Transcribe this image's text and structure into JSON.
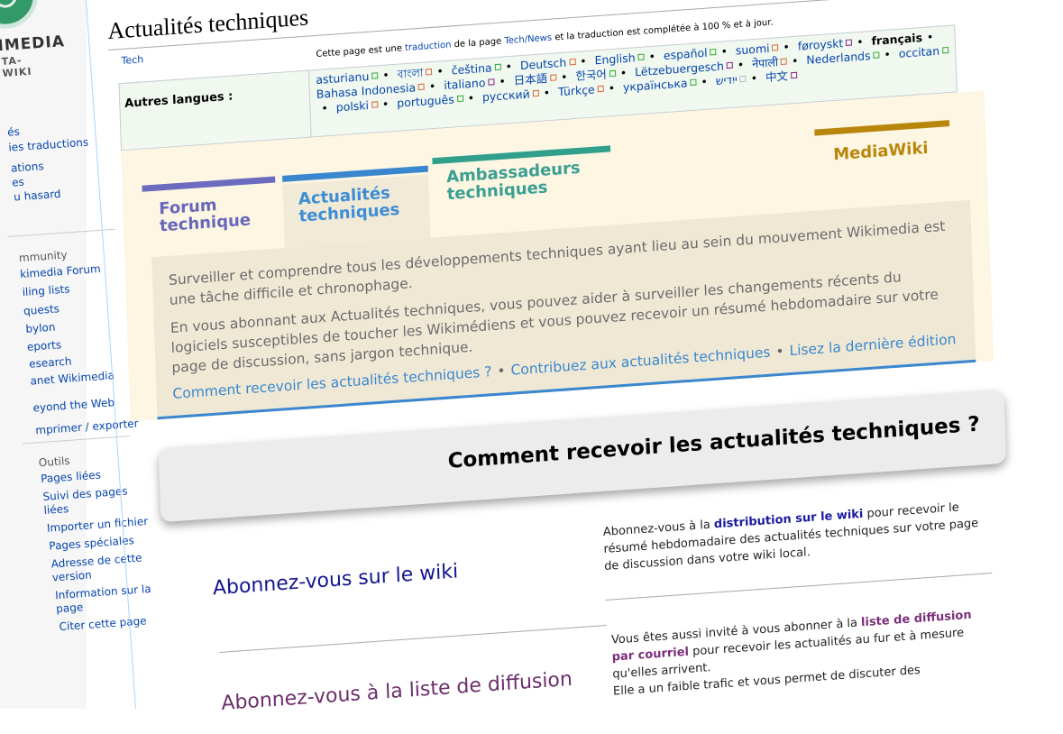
{
  "brand": {
    "logo_text": "IMEDIA",
    "logo_subtext": "TA-WIKI"
  },
  "sidebar": {
    "main_items": [
      {
        "label": "és"
      },
      {
        "label": "ies traductions"
      },
      {
        "label": "ations"
      },
      {
        "label": "es"
      },
      {
        "label": "u hasard"
      }
    ],
    "community_heading": "mmunity",
    "community_items": [
      {
        "label": "kimedia Forum"
      },
      {
        "label": "iling lists"
      },
      {
        "label": "quests"
      },
      {
        "label": "bylon"
      },
      {
        "label": "eports"
      },
      {
        "label": "esearch"
      },
      {
        "label": "anet Wikimedia"
      },
      {
        "label": "eyond the Web"
      }
    ],
    "print_item": "mprimer / exporter",
    "tools_heading": "Outils",
    "tools_items": [
      {
        "label": "Pages liées"
      },
      {
        "label": "Suivi des pages liées"
      },
      {
        "label": "Importer un fichier"
      },
      {
        "label": "Pages spéciales"
      },
      {
        "label": "Adresse de cette version"
      },
      {
        "label": "Information sur la page"
      },
      {
        "label": "Citer cette page"
      }
    ]
  },
  "page": {
    "title": "Actualités techniques",
    "breadcrumb": "Tech",
    "translation_notice": {
      "prefix": "Cette page est une ",
      "link1": "traduction",
      "middle": " de la page ",
      "link2": "Tech/News",
      "suffix": " et la traduction est complétée à 100 % et à jour."
    }
  },
  "languages": {
    "label": "Autres langues :",
    "items": [
      {
        "name": "asturianu",
        "status": "g"
      },
      {
        "name": "বাংলা",
        "status": "o"
      },
      {
        "name": "čeština",
        "status": "g"
      },
      {
        "name": "Deutsch",
        "status": "o"
      },
      {
        "name": "English",
        "status": "g"
      },
      {
        "name": "español",
        "status": "g"
      },
      {
        "name": "suomi",
        "status": "o"
      },
      {
        "name": "føroyskt",
        "status": "p"
      },
      {
        "name": "français",
        "status": ""
      },
      {
        "name": "Bahasa Indonesia",
        "status": "o"
      },
      {
        "name": "italiano",
        "status": "p"
      },
      {
        "name": "日本語",
        "status": "o"
      },
      {
        "name": "한국어",
        "status": "g"
      },
      {
        "name": "Lëtzebuergesch",
        "status": "p"
      },
      {
        "name": "नेपाली",
        "status": "o"
      },
      {
        "name": "Nederlands",
        "status": "g"
      },
      {
        "name": "occitan",
        "status": "g"
      },
      {
        "name": "polski",
        "status": "o"
      },
      {
        "name": "português",
        "status": "g"
      },
      {
        "name": "русский",
        "status": "o"
      },
      {
        "name": "Türkçe",
        "status": "o"
      },
      {
        "name": "українська",
        "status": "g"
      },
      {
        "name": "ייִדיש",
        "status": "x"
      },
      {
        "name": "中文",
        "status": "p"
      }
    ]
  },
  "tabs": {
    "forum": "Forum technique",
    "actualites": "Actualités techniques",
    "ambassadeurs": "Ambassadeurs techniques",
    "mediawiki": "MediaWiki"
  },
  "intro": {
    "p1": "Surveiller et comprendre tous les développements techniques ayant lieu au sein du mouvement Wikimedia est une tâche difficile et chronophage.",
    "p2": "En vous abonnant aux Actualités techniques, vous pouvez aider à surveiller les changements récents du logiciels susceptibles de toucher les Wikimédiens et vous pouvez recevoir un résumé hebdomadaire sur votre page de discussion, sans jargon technique.",
    "links": [
      "Comment recevoir les actualités techniques ?",
      "Contribuez aux actualités techniques",
      "Lisez la dernière édition"
    ],
    "dot": "•"
  },
  "section": {
    "heading": "Comment recevoir les actualités techniques ?"
  },
  "rows": [
    {
      "title": "Abonnez-vous sur le wiki",
      "desc_prefix": "Abonnez-vous à la ",
      "desc_link": "distribution sur le wiki",
      "desc_suffix": " pour recevoir le résumé hebdomadaire des actualités techniques sur votre page de discussion dans votre wiki local."
    },
    {
      "title": "Abonnez-vous à la liste de diffusion",
      "desc_prefix": "Vous êtes aussi invité à vous abonner à la ",
      "desc_link": "liste de diffusion par courriel",
      "desc_suffix": " pour recevoir les actualités au fur et à mesure qu'elles arrivent.",
      "desc_extra": "Elle a un faible trafic et vous permet de discuter des"
    }
  ],
  "colors": {
    "forum": "#6b6bc0",
    "actualites": "#3a87cf",
    "ambassadeurs": "#30a08c",
    "mediawiki": "#b8860b",
    "panel_bg": "#fdf6e3"
  }
}
